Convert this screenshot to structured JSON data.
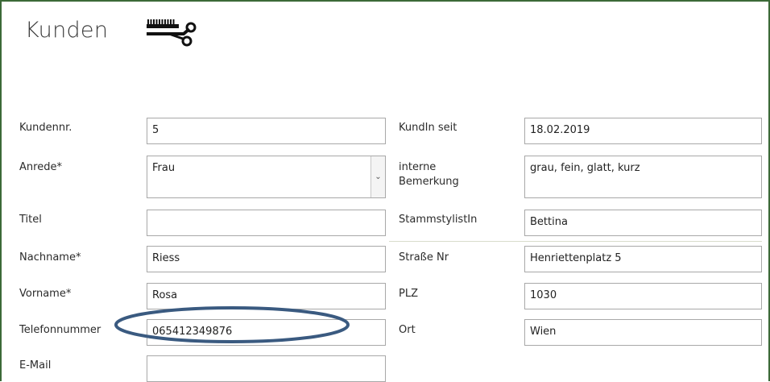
{
  "header": {
    "title": "Kunden",
    "logo_icon": "comb-scissors-icon"
  },
  "left_fields": [
    {
      "label": "Kundennr.",
      "value": "5"
    },
    {
      "label": "Anrede*",
      "value": "Frau"
    },
    {
      "label": "Titel",
      "value": ""
    },
    {
      "label": "Nachname*",
      "value": "Riess"
    },
    {
      "label": "Vorname*",
      "value": "Rosa"
    },
    {
      "label": "Telefonnummer",
      "value": "065412349876"
    },
    {
      "label": "E-Mail",
      "value": ""
    }
  ],
  "right_fields": [
    {
      "label": "KundIn seit",
      "value": "18.02.2019"
    },
    {
      "label": "interne Bemerkung",
      "value": "grau, fein, glatt, kurz"
    },
    {
      "label": "StammstylistIn",
      "value": "Bettina"
    },
    {
      "label": "Straße Nr",
      "value": "Henriettenplatz 5"
    },
    {
      "label": "PLZ",
      "value": "1030"
    },
    {
      "label": "Ort",
      "value": "Wien"
    }
  ],
  "colors": {
    "frame": "#3c6a38",
    "highlight_ellipse": "#3a5a80"
  }
}
